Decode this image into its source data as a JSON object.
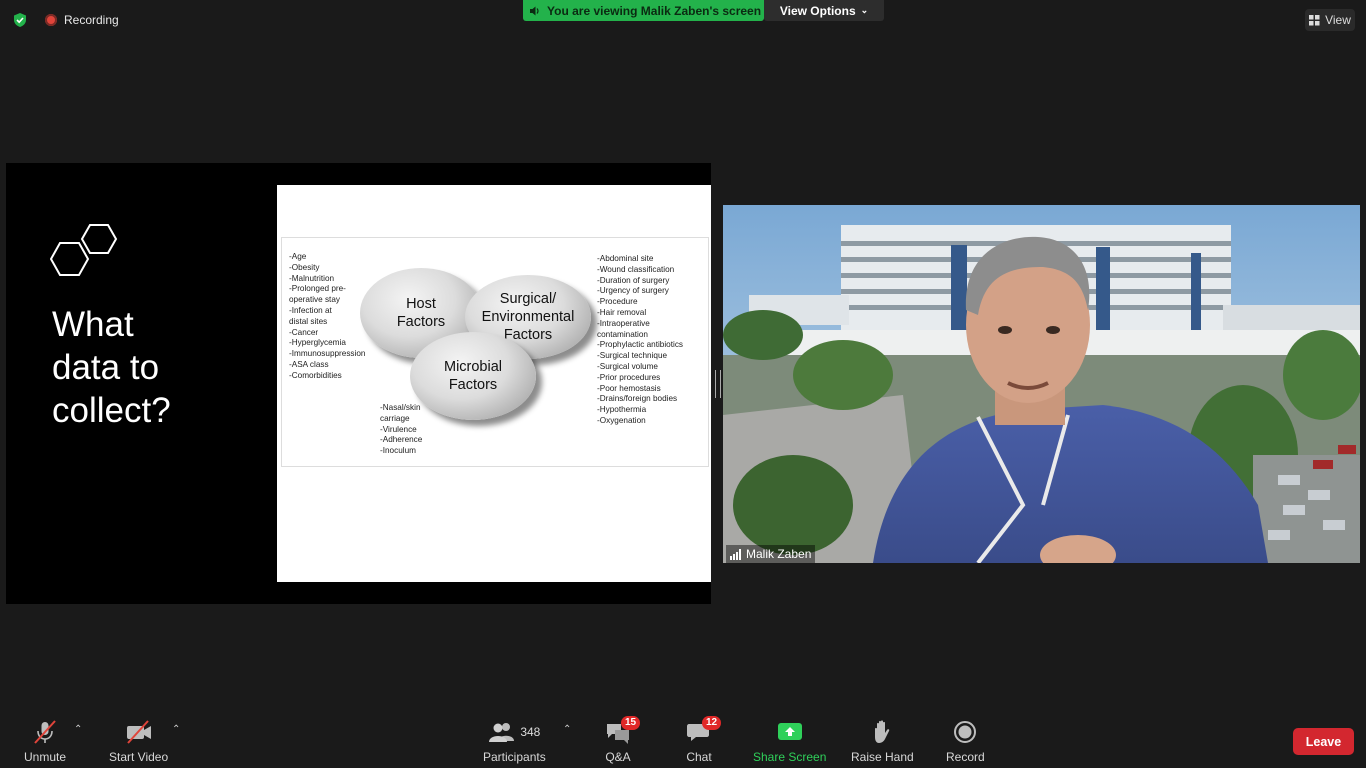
{
  "top_bar": {
    "recording_label": "Recording",
    "viewing_banner": "You are viewing Malik Zaben's screen",
    "view_options_label": "View Options",
    "view_label": "View"
  },
  "slide": {
    "title": "What\ndata to\ncollect?",
    "figure": {
      "host_factors": "Host\nFactors",
      "surgical_factors": "Surgical/\nEnvironmental\nFactors",
      "microbial_factors": "Microbial\nFactors",
      "host_list": "-Age\n-Obesity\n-Malnutrition\n-Prolonged pre-\n  operative stay\n-Infection at\n  distal sites\n-Cancer\n-Hyperglycemia\n-Immunosuppression\n-ASA class\n-Comorbidities",
      "microbial_list": "-Nasal/skin\n  carriage\n-Virulence\n-Adherence\n-Inoculum",
      "surgical_list": "-Abdominal site\n-Wound classification\n-Duration of surgery\n-Urgency of surgery\n-Procedure\n-Hair removal\n-Intraoperative\n  contamination\n-Prophylactic antibiotics\n-Surgical technique\n-Surgical volume\n-Prior procedures\n-Poor hemostasis\n-Drains/foreign bodies\n-Hypothermia\n-Oxygenation"
    }
  },
  "video": {
    "participant_name": "Malik Zaben"
  },
  "toolbar": {
    "unmute_label": "Unmute",
    "start_video_label": "Start Video",
    "participants_label": "Participants",
    "participants_count": "348",
    "qa_label": "Q&A",
    "qa_badge": "15",
    "chat_label": "Chat",
    "chat_badge": "12",
    "share_screen_label": "Share Screen",
    "raise_hand_label": "Raise Hand",
    "record_label": "Record",
    "leave_label": "Leave"
  },
  "colors": {
    "background": "#1a1a1a",
    "banner_green": "#23b24b",
    "share_green": "#2fd05a",
    "leave_red": "#d3272f",
    "badge_red": "#e02828"
  }
}
